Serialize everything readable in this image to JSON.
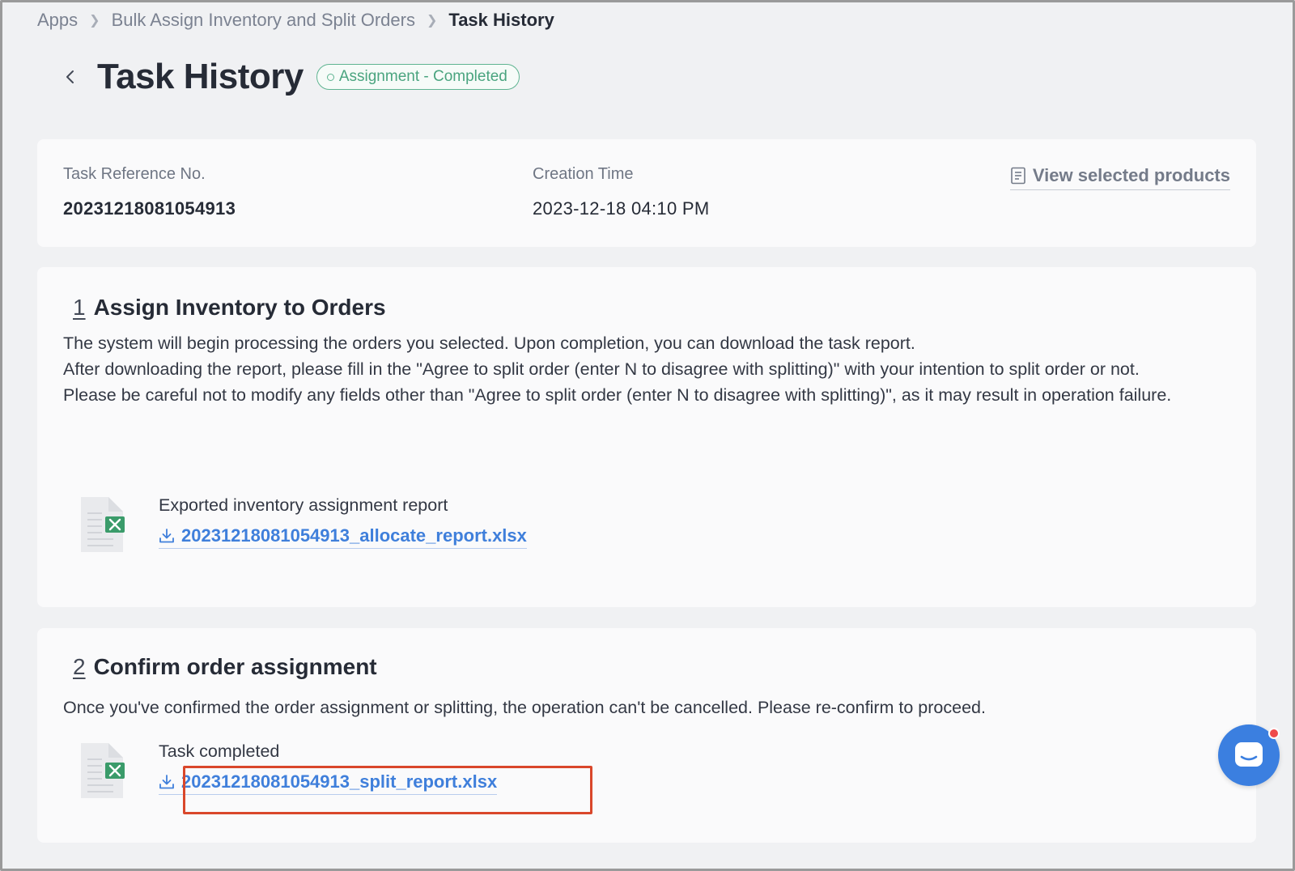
{
  "breadcrumb": {
    "items": [
      "Apps",
      "Bulk Assign Inventory and Split Orders"
    ],
    "current": "Task History"
  },
  "header": {
    "title": "Task History",
    "status": "Assignment - Completed"
  },
  "info": {
    "ref_label": "Task Reference No.",
    "ref_value": "20231218081054913",
    "time_label": "Creation Time",
    "time_value": "2023-12-18 04:10 PM",
    "view_link": "View selected products"
  },
  "step1": {
    "number": "1",
    "title": "Assign Inventory to Orders",
    "lines": [
      "The system will begin processing the orders you selected. Upon completion, you can download the task report.",
      "After downloading the report, please fill in the \"Agree to split order (enter N to disagree with splitting)\" with your intention to split order or not.",
      "Please be careful not to modify any fields other than \"Agree to split order (enter N to disagree with splitting)\", as it may result in operation failure."
    ],
    "file_caption": "Exported inventory assignment report",
    "file_name": "20231218081054913_allocate_report.xlsx"
  },
  "step2": {
    "number": "2",
    "title": "Confirm order assignment",
    "desc": "Once you've confirmed the order assignment or splitting, the operation can't be cancelled. Please re-confirm to proceed.",
    "file_caption": "Task completed",
    "file_name": "20231218081054913_split_report.xlsx"
  },
  "colors": {
    "accent": "#3f7fdb",
    "success": "#4aa47f",
    "highlight": "#d9472b",
    "excel": "#3a9b6a"
  }
}
